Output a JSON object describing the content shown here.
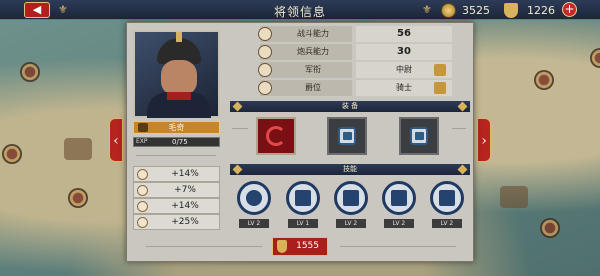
{
  "header": {
    "title": "将领信息",
    "back_icon": "back-arrow-icon",
    "gold": "3525",
    "medals": "1226",
    "add_symbol": "+"
  },
  "general": {
    "name": "毛奇",
    "exp_label": "EXP",
    "exp_text": "0/75",
    "exp_progress": 0
  },
  "bonuses": [
    {
      "icon": "infantry-bonus-icon",
      "value": "+14%"
    },
    {
      "icon": "artillery-bonus-icon",
      "value": "+7%"
    },
    {
      "icon": "cavalry-bonus-icon",
      "value": "+14%"
    },
    {
      "icon": "defense-bonus-icon",
      "value": "+25%"
    }
  ],
  "stats": [
    {
      "label": "战斗能力",
      "value": "56",
      "icon": "combat-icon"
    },
    {
      "label": "炮兵能力",
      "value": "30",
      "icon": "artillery-icon"
    },
    {
      "label": "军衔",
      "value": "中尉",
      "icon": "rank-icon"
    },
    {
      "label": "爵位",
      "value": "骑士",
      "icon": "title-icon"
    }
  ],
  "equipment": {
    "header": "装 备",
    "slots": [
      {
        "state": "equipped",
        "icon": "equipment-emblem-icon"
      },
      {
        "state": "locked",
        "icon": "lock-icon"
      },
      {
        "state": "locked",
        "icon": "lock-icon"
      }
    ]
  },
  "skills": {
    "header": "技能",
    "items": [
      {
        "icon": "cannonball-skill-icon",
        "level": "LV 2"
      },
      {
        "icon": "fortress-skill-icon",
        "level": "LV 1"
      },
      {
        "icon": "bayonet-skill-icon",
        "level": "LV 2"
      },
      {
        "icon": "bugle-skill-icon",
        "level": "LV 2"
      },
      {
        "icon": "flag-skill-icon",
        "level": "LV 2"
      }
    ]
  },
  "upgrade": {
    "cost": "1555",
    "icon": "medal-icon"
  },
  "colors": {
    "accent_red": "#b21f1f",
    "header_navy": "#2d3b57",
    "gold": "#d9b25a"
  }
}
